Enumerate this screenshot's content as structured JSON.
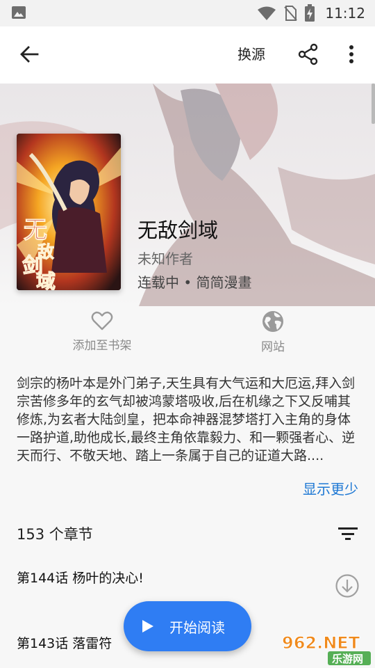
{
  "status_bar": {
    "time": "11:12",
    "icons": [
      "gallery-icon",
      "wifi-icon",
      "no-sim-icon",
      "battery-charging-icon"
    ]
  },
  "app_bar": {
    "source_label": "换源",
    "icons": [
      "back-arrow-icon",
      "share-icon",
      "more-vert-icon"
    ]
  },
  "book": {
    "title": "无敌剑域",
    "author": "未知作者",
    "meta": "连载中 • 简简漫畫",
    "cover_text": "无敌剑域"
  },
  "actions": {
    "shelf_label": "添加至书架",
    "site_label": "网站"
  },
  "summary": {
    "text": "剑宗的杨叶本是外门弟子,天生具有大气运和大厄运,拜入剑宗苦修多年的玄气却被鸿蒙塔吸收,后在机缘之下又反哺其修炼,为玄者大陆剑皇，把本命神器混梦塔打入主角的身体一路护道,助他成长,最终主角依靠毅力、和一颗强者心、逆天而行、不敬天地、踏上一条属于自己的证道大路....",
    "toggle_label": "显示更少"
  },
  "chapters": {
    "count_label": "153 个章节",
    "items": [
      {
        "title": "第144话 杨叶的决心!"
      },
      {
        "title": "第143话 落雷符"
      }
    ]
  },
  "fab": {
    "label": "开始阅读"
  },
  "watermark": {
    "text_top": "962.NET",
    "text_bottom": "乐游网"
  },
  "colors": {
    "accent": "#2f7df3",
    "link": "#1e78d4"
  }
}
